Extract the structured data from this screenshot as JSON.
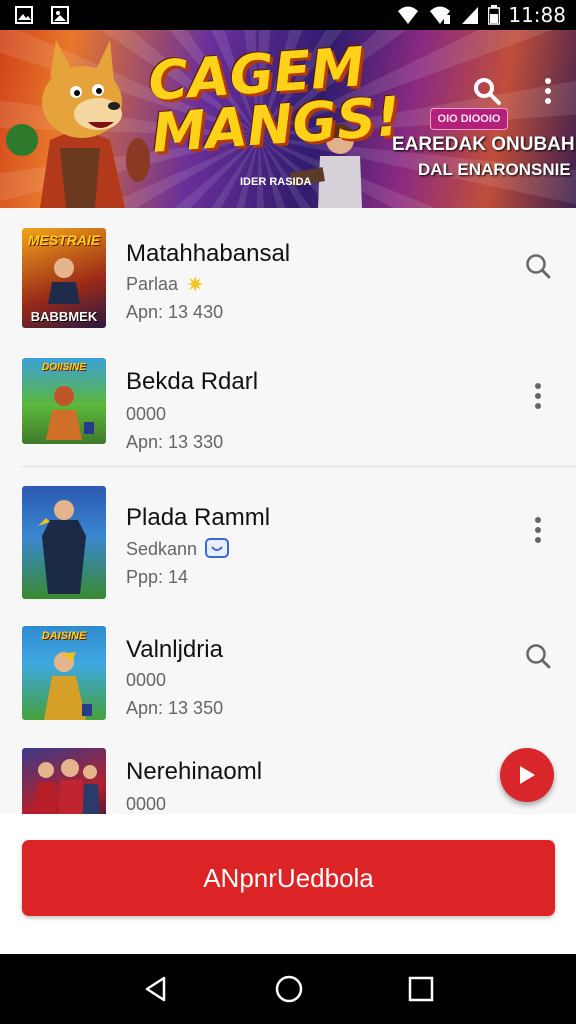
{
  "status_bar": {
    "time": "11:88",
    "icons": [
      "gallery-icon",
      "image-icon",
      "wifi-icon",
      "wifi-signal-icon",
      "cell-signal-icon",
      "battery-icon"
    ]
  },
  "banner": {
    "title_line1": "CAGEM",
    "title_line2": "MANGS!",
    "subtitle": "IDER RASIDA",
    "promo_badge": "OIO DIOOIO",
    "promo_line1": "EAREDAK ONUBAH",
    "promo_line2": "DAL ENARONSNIE",
    "icons": [
      "search-icon",
      "more-vert-icon"
    ]
  },
  "apps": [
    {
      "title": "Matahhabansal",
      "line1": "Parlaa",
      "line1_icon": "star-icon",
      "line2": "Apn: 13 430",
      "thumb_text": "MESTRAIE",
      "thumb_subtext": "BABBMEK",
      "action": "search-icon"
    },
    {
      "title": "Bekda Rdarl",
      "line1": "0000",
      "line2": "Apn: 13 330",
      "thumb_text": "DOIISINE",
      "thumb_subtext": "",
      "action": "more-vert-icon"
    },
    {
      "title": "Plada Ramml",
      "line1": "Sedkann",
      "line1_icon": "chat-icon",
      "line2": "Ppp: 14",
      "thumb_text": "",
      "thumb_subtext": "",
      "action": "more-vert-icon"
    },
    {
      "title": "Valnljdria",
      "line1": "0000",
      "line2": "Apn: 13 350",
      "thumb_text": "DAISINE",
      "thumb_subtext": "",
      "action": "search-icon"
    },
    {
      "title": "Nerehinaoml",
      "line1": "0000",
      "line2": "",
      "thumb_text": "",
      "thumb_subtext": "",
      "action": ""
    }
  ],
  "fab": {
    "icon": "play-icon"
  },
  "cta": {
    "label": "ANpnrUedbola"
  },
  "nav": {
    "icons": [
      "back-icon",
      "home-icon",
      "recents-icon"
    ]
  },
  "colors": {
    "accent": "#dc2326",
    "status_bar": "#000000",
    "list_bg": "#f7f7f7"
  }
}
